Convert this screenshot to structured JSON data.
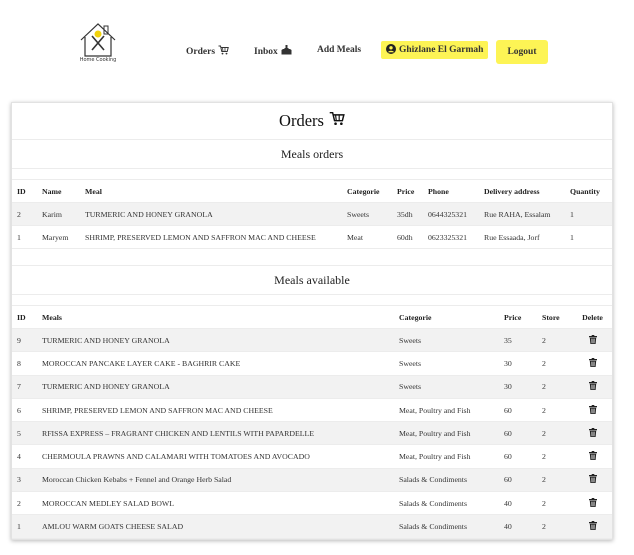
{
  "brand": {
    "logo_text": "Home Cooking"
  },
  "nav": {
    "orders_label": "Orders",
    "inbox_label": "Inbox",
    "add_meals_label": "Add Meals",
    "user_label": "Ghizlane El Garmah",
    "logout_label": "Logout"
  },
  "page": {
    "title": "Orders",
    "orders_section_title": "Meals orders",
    "available_section_title": "Meals available"
  },
  "orders_table": {
    "headers": [
      "ID",
      "Name",
      "Meal",
      "Categorie",
      "Price",
      "Phone",
      "Delivery address",
      "Quantity"
    ],
    "rows": [
      [
        "2",
        "Karim",
        "TURMERIC AND HONEY GRANOLA",
        "Sweets",
        "35dh",
        "0644325321",
        "Rue RAHA, Essalam",
        "1"
      ],
      [
        "1",
        "Maryem",
        "SHRIMP, PRESERVED LEMON AND SAFFRON MAC AND CHEESE",
        "Meat",
        "60dh",
        "0623325321",
        "Rue Essaada, Jorf",
        "1"
      ]
    ]
  },
  "meals_table": {
    "headers": [
      "ID",
      "Meals",
      "Categorie",
      "Price",
      "Store",
      "Delete"
    ],
    "rows": [
      [
        "9",
        "TURMERIC AND HONEY GRANOLA",
        "Sweets",
        "35",
        "2"
      ],
      [
        "8",
        "MOROCCAN PANCAKE LAYER CAKE - BAGHRIR CAKE",
        "Sweets",
        "30",
        "2"
      ],
      [
        "7",
        "TURMERIC AND HONEY GRANOLA",
        "Sweets",
        "30",
        "2"
      ],
      [
        "6",
        "SHRIMP, PRESERVED LEMON AND SAFFRON MAC AND CHEESE",
        "Meat, Poultry and Fish",
        "60",
        "2"
      ],
      [
        "5",
        "RFISSA EXPRESS – FRAGRANT CHICKEN AND LENTILS WITH PAPARDELLE",
        "Meat, Poultry and Fish",
        "60",
        "2"
      ],
      [
        "4",
        "CHERMOULA PRAWNS AND CALAMARI WITH TOMATOES AND AVOCADO",
        "Meat, Poultry and Fish",
        "60",
        "2"
      ],
      [
        "3",
        "Moroccan Chicken Kebabs + Fennel and Orange Herb Salad",
        "Salads & Condiments",
        "60",
        "2"
      ],
      [
        "2",
        "MOROCCAN MEDLEY SALAD BOWL",
        "Salads & Condiments",
        "40",
        "2"
      ],
      [
        "1",
        "AMLOU WARM GOATS CHEESE SALAD",
        "Salads & Condiments",
        "40",
        "2"
      ]
    ]
  },
  "icons": {
    "orders": "cart-icon",
    "inbox": "inbox-tray-icon",
    "user": "user-circle-icon",
    "delete": "trash-icon"
  },
  "colors": {
    "accent": "#fdf455",
    "row_stripe": "#f2f2f2"
  }
}
